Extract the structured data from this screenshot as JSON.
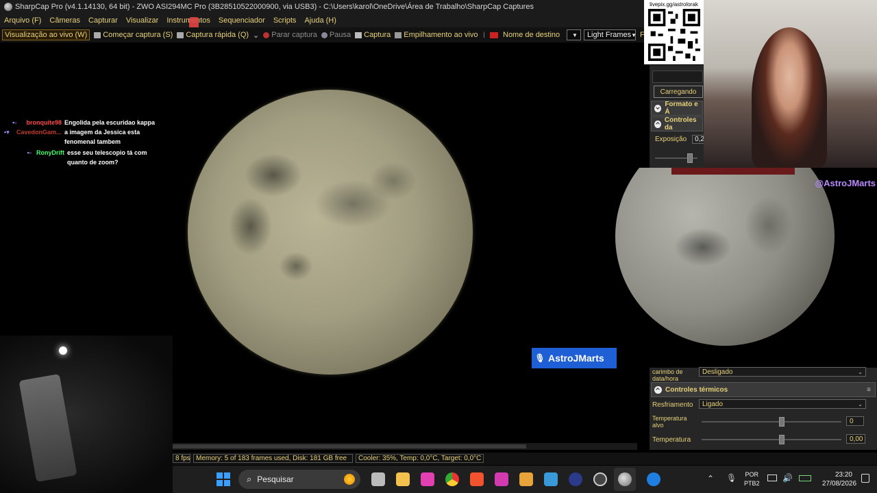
{
  "window": {
    "title": "SharpCap Pro (v4.1.14130, 64 bit) - ZWO ASI294MC Pro (3B28510522000900, via USB3) - C:\\Users\\karol\\OneDrive\\Área de Trabalho\\SharpCap Captures"
  },
  "menu": [
    "Arquivo (F)",
    "Câmeras",
    "Capturar",
    "Visualizar",
    "Instrumentos",
    "Sequenciador",
    "Scripts",
    "Ajuda (H)"
  ],
  "toolbar": {
    "live_view": "Visualização ao vivo (W)",
    "start_capture": "Começar captura (S)",
    "quick_capture": "Captura rápida (Q)",
    "stop_capture": "Parar captura",
    "pause": "Pausa",
    "capture": "Captura",
    "live_stack": "Empilhamento ao vivo",
    "target_name_label": "Nome de destino",
    "target_name_value": "",
    "frame_type": "Light Frames",
    "fx": "FX"
  },
  "chat": [
    {
      "user": "bronquite98",
      "user_color": "#ff4a4a",
      "message": "Engolida pela escuridao kappa"
    },
    {
      "user": "CavedonGam...",
      "user_color": "#c0392b",
      "message": "a imagem da Jessica esta fenomenal tambem"
    },
    {
      "user": "RonyDrift",
      "user_color": "#44ff6a",
      "message": "esse seu telescopio tá com quanto de zoom?"
    }
  ],
  "qr": {
    "label": "livepix.gg/astrolorak"
  },
  "panel": {
    "loading_button": "Carregando",
    "format_section": "Formato e Á",
    "controls_section": "Controles da",
    "exposure_label": "Exposição",
    "exposure_value": "0,2"
  },
  "panel2": {
    "timestamp_label": "carimbo de data/hora",
    "timestamp_value": "Desligado",
    "thermal_section": "Controles térmicos",
    "cooling_label": "Resfriamento",
    "cooling_value": "Ligado",
    "target_temp_label": "Temperatura alvo",
    "target_temp_value": "0",
    "temperature_label": "Temperatura",
    "temperature_value": "0,00"
  },
  "overlay": {
    "handle": "@AstroJMarts",
    "name_badge": "AstroJMarts"
  },
  "status": {
    "fps": "8 fps",
    "memory": "Memory: 5 of 183 frames used, Disk: 181 GB free",
    "cooler": "Cooler: 35%, Temp: 0,0°C, Target: 0,0°C"
  },
  "taskbar": {
    "search_placeholder": "Pesquisar",
    "lang_top": "POR",
    "lang_bottom": "PTB2",
    "time": "23:20",
    "date": "27/08/2026"
  },
  "colors": {
    "accent": "#e8d27a",
    "handle": "#b98aff",
    "badge": "#1e5fd6"
  }
}
